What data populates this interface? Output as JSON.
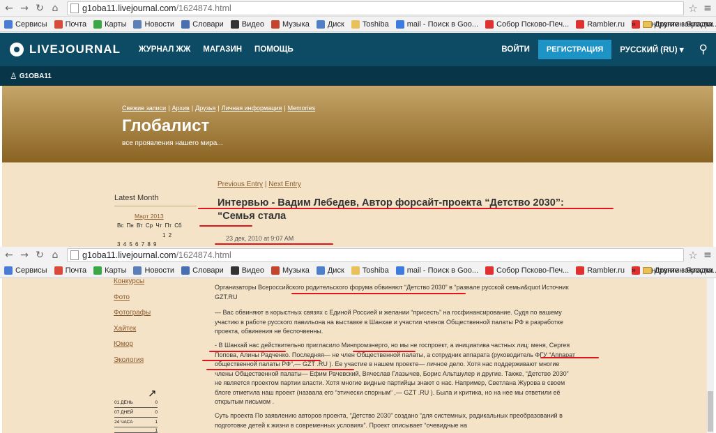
{
  "browser_top": {
    "url_host": "g1oba11.livejournal.com",
    "url_path": "/1624874.html",
    "back_icon": "back-arrow-icon",
    "forward_icon": "forward-arrow-icon",
    "reload_icon": "reload-icon",
    "home_icon": "home-icon"
  },
  "bookmarks": {
    "items": [
      {
        "label": "Сервисы",
        "color": "#4a7cd6"
      },
      {
        "label": "Почта",
        "color": "#d84a3a"
      },
      {
        "label": "Карты",
        "color": "#3aa845"
      },
      {
        "label": "Новости",
        "color": "#5b7fb8"
      },
      {
        "label": "Словари",
        "color": "#4a6fb0"
      },
      {
        "label": "Видео",
        "color": "#333333"
      },
      {
        "label": "Музыка",
        "color": "#c4452c"
      },
      {
        "label": "Диск",
        "color": "#4f7fc8"
      },
      {
        "label": "Toshiba",
        "color": "#e8c15b"
      },
      {
        "label": "mail - Поиск в Goo...",
        "color": "#3d7be0"
      },
      {
        "label": "Собор Псково-Печ...",
        "color": "#e03030"
      },
      {
        "label": "Rambler.ru",
        "color": "#e03030"
      },
      {
        "label": "Константин Яросла...",
        "color": "#e03030"
      }
    ],
    "more": "»",
    "other": "Другие закладки",
    "other2": "Другие закладки"
  },
  "lj": {
    "logo": "LIVEJOURNAL",
    "nav": [
      "ЖУРНАЛ ЖЖ",
      "МАГАЗИН",
      "ПОМОЩЬ"
    ],
    "login": "ВОЙТИ",
    "register": "РЕГИСТРАЦИЯ",
    "language": "РУССКИЙ (RU)",
    "caret": "▾",
    "username": "G1OBA11"
  },
  "blog": {
    "links": [
      "Свежие записи",
      "Архив",
      "Друзья",
      "Личная информация",
      "Memories"
    ],
    "sep": "|",
    "title": "Глобалист",
    "subtitle": "все проявления нашего мира..."
  },
  "sidebar": {
    "latest": "Latest Month",
    "month": "Март 2013",
    "weekdays": "Вс Пн Вт Ср Чт Пт Сб",
    "row1": "1 2",
    "row2": "3 4 5 6 7 8 9"
  },
  "entry": {
    "prev": "Previous Entry",
    "next": "Next Entry",
    "nav_sep": "|",
    "title": "Интервью - Вадим Лебедев, Автор форсайт-проекта “Детство 2030”: “Семья стала",
    "date": "23 дек, 2010 at 9:07 AM"
  },
  "sidebar2": {
    "links": [
      "Конкурсы",
      "Фото",
      "Фотографы",
      "Хайтек",
      "Юмор",
      "Экология"
    ],
    "counters": [
      {
        "label": "01 ДЕНЬ",
        "value": "0"
      },
      {
        "label": "07 ДНЕЙ",
        "value": "0"
      },
      {
        "label": "24 ЧАСА",
        "value": "1"
      },
      {
        "label": "",
        "value": "1"
      }
    ]
  },
  "article": {
    "p1": "Организаторы Всероссийского родительского форума обвиняют “Детство 2030” в “развале русской семьи&quot Источник GZT.RU",
    "p2": "— Вас обвиняют в корыстных связях с Единой Россией и желании “присесть” на госфинансирование. Судя по вашему участию в работе русского павильона на выставке в Шанхае и участии членов Общественной палаты РФ в разработке проекта, обвинения не беспочвенны.",
    "p3": "- В Шанхай нас действительно пригласило Минпромэнерго, но мы не госпроект, а инициатива частных лиц: меня, Сергея Попова, Алины Радченко. Последняя— не член Общественной палаты, а сотрудник аппарата (руководитель ФГУ “Аппарат общественной палаты РФ”,— GZT .RU ). Ее участие в нашем проекте— личное дело. Хотя нас поддерживают многие члены Общественной палаты— Ефим Рачевский, Вячеслав Глазычев, Борис Альтшулер и другие. Также, “Детство 2030” не является проектом партии власти. Хотя многие видные партийцы знают о нас. Например, Светлана Журова в своем блоге отметила наш проект (назвала его “этически спорным” ,— GZT .RU ). Была и критика, но на нее мы ответили её открытым письмом .",
    "p4": "Суть проекта По заявлению авторов проекта, “Детство 2030” создано “для системных, радикальных преобразований в подготовке детей к жизни в современных условиях”. Проект описывает “очевидные на"
  }
}
